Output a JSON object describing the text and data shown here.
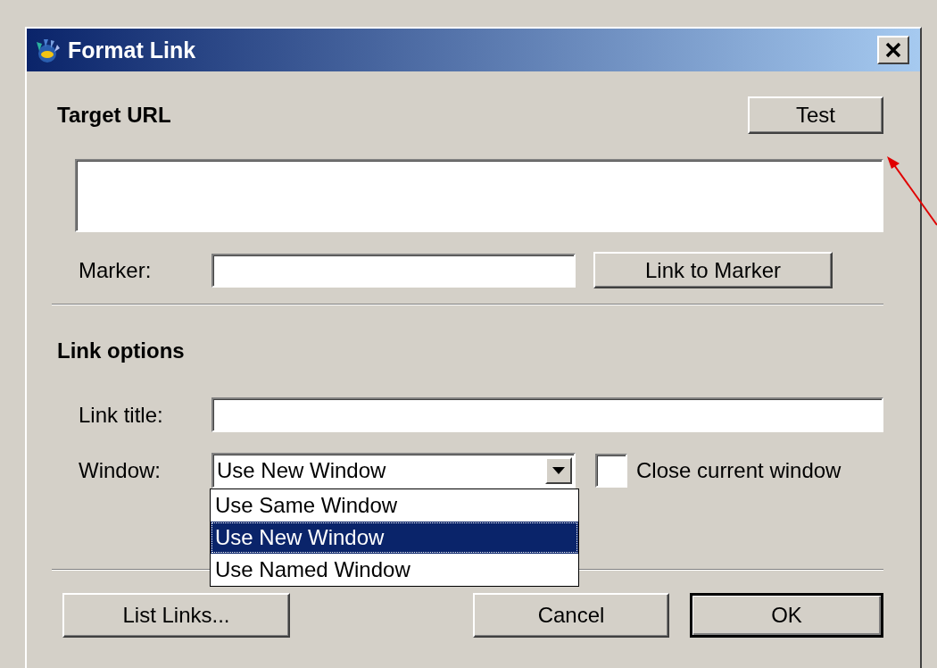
{
  "window": {
    "title": "Format Link"
  },
  "target_url": {
    "label": "Target URL",
    "test_button": "Test"
  },
  "marker": {
    "label": "Marker:",
    "button": "Link to Marker"
  },
  "link_options": {
    "heading": "Link options",
    "link_title_label": "Link title:",
    "window_label": "Window:",
    "window_select": {
      "value": "Use New Window",
      "expanded": true,
      "options": [
        {
          "label": "Use Same Window",
          "selected": false
        },
        {
          "label": "Use New Window",
          "selected": true
        },
        {
          "label": "Use Named Window",
          "selected": false
        }
      ]
    },
    "close_current_window": {
      "label": "Close current window",
      "checked": false
    }
  },
  "buttons": [
    {
      "label": "List Links...",
      "default": false
    },
    {
      "label": "Cancel",
      "default": false
    },
    {
      "label": "OK",
      "default": true
    }
  ]
}
